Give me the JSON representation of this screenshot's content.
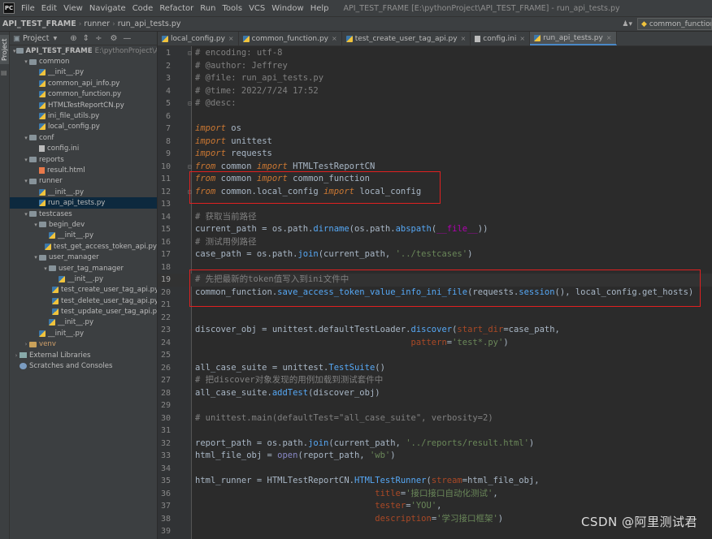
{
  "window": {
    "title": "API_TEST_FRAME [E:\\pythonProject\\API_TEST_FRAME] - run_api_tests.py",
    "menu": [
      "File",
      "Edit",
      "View",
      "Navigate",
      "Code",
      "Refactor",
      "Run",
      "Tools",
      "VCS",
      "Window",
      "Help"
    ]
  },
  "navbar": {
    "crumbs": [
      "API_TEST_FRAME",
      "runner",
      "run_api_tests.py"
    ],
    "run_config": "common_function"
  },
  "side_tab": "Project",
  "project": {
    "header": "Project",
    "tree": [
      {
        "label": "API_TEST_FRAME",
        "extra": "E:\\pythonProject\\AP",
        "type": "folder",
        "indent": 0,
        "open": true,
        "bold": true
      },
      {
        "label": "common",
        "type": "folder",
        "indent": 1,
        "open": true
      },
      {
        "label": "__init__.py",
        "type": "py",
        "indent": 2
      },
      {
        "label": "common_api_info.py",
        "type": "py",
        "indent": 2
      },
      {
        "label": "common_function.py",
        "type": "py",
        "indent": 2
      },
      {
        "label": "HTMLTestReportCN.py",
        "type": "py",
        "indent": 2
      },
      {
        "label": "ini_file_utils.py",
        "type": "py",
        "indent": 2
      },
      {
        "label": "local_config.py",
        "type": "py",
        "indent": 2
      },
      {
        "label": "conf",
        "type": "folder",
        "indent": 1,
        "open": true
      },
      {
        "label": "config.ini",
        "type": "file",
        "indent": 2
      },
      {
        "label": "reports",
        "type": "folder",
        "indent": 1,
        "open": true
      },
      {
        "label": "result.html",
        "type": "html",
        "indent": 2
      },
      {
        "label": "runner",
        "type": "folder",
        "indent": 1,
        "open": true
      },
      {
        "label": "__init__.py",
        "type": "py",
        "indent": 2
      },
      {
        "label": "run_api_tests.py",
        "type": "py",
        "indent": 2,
        "selected": true
      },
      {
        "label": "testcases",
        "type": "folder",
        "indent": 1,
        "open": true
      },
      {
        "label": "begin_dev",
        "type": "folder",
        "indent": 2,
        "open": true
      },
      {
        "label": "__init__.py",
        "type": "py",
        "indent": 3
      },
      {
        "label": "test_get_access_token_api.py",
        "type": "py",
        "indent": 3
      },
      {
        "label": "user_manager",
        "type": "folder",
        "indent": 2,
        "open": true
      },
      {
        "label": "user_tag_manager",
        "type": "folder",
        "indent": 3,
        "open": true
      },
      {
        "label": "__init__.py",
        "type": "py",
        "indent": 4
      },
      {
        "label": "test_create_user_tag_api.py",
        "type": "py",
        "indent": 4
      },
      {
        "label": "test_delete_user_tag_api.py",
        "type": "py",
        "indent": 4
      },
      {
        "label": "test_update_user_tag_api.py",
        "type": "py",
        "indent": 4
      },
      {
        "label": "__init__.py",
        "type": "py",
        "indent": 3
      },
      {
        "label": "__init__.py",
        "type": "py",
        "indent": 2
      },
      {
        "label": "venv",
        "type": "folder",
        "indent": 1,
        "open": false,
        "orange": true
      },
      {
        "label": "External Libraries",
        "type": "lib",
        "indent": 0,
        "open": false
      },
      {
        "label": "Scratches and Consoles",
        "type": "scratch",
        "indent": 0
      }
    ]
  },
  "tabs": [
    {
      "label": "local_config.py",
      "active": false
    },
    {
      "label": "common_function.py",
      "active": false
    },
    {
      "label": "test_create_user_tag_api.py",
      "active": false
    },
    {
      "label": "config.ini",
      "active": false
    },
    {
      "label": "run_api_tests.py",
      "active": true
    }
  ],
  "editor": {
    "current_line": 19,
    "lines": [
      {
        "n": 1,
        "tokens": [
          [
            "com",
            "# encoding: utf-8"
          ]
        ]
      },
      {
        "n": 2,
        "tokens": [
          [
            "com",
            "# @author: Jeffrey"
          ]
        ]
      },
      {
        "n": 3,
        "tokens": [
          [
            "com",
            "# @file: run_api_tests.py"
          ]
        ]
      },
      {
        "n": 4,
        "tokens": [
          [
            "com",
            "# @time: 2022/7/24 17:52"
          ]
        ]
      },
      {
        "n": 5,
        "tokens": [
          [
            "com",
            "# @desc:"
          ]
        ]
      },
      {
        "n": 6,
        "tokens": []
      },
      {
        "n": 7,
        "tokens": [
          [
            "kwimp",
            "import"
          ],
          [
            "plain",
            " os"
          ]
        ]
      },
      {
        "n": 8,
        "tokens": [
          [
            "kwimp",
            "import"
          ],
          [
            "plain",
            " unittest"
          ]
        ]
      },
      {
        "n": 9,
        "tokens": [
          [
            "kwimp",
            "import"
          ],
          [
            "plain",
            " requests"
          ]
        ]
      },
      {
        "n": 10,
        "tokens": [
          [
            "kwimp",
            "from"
          ],
          [
            "plain",
            " common "
          ],
          [
            "kwimp",
            "import"
          ],
          [
            "plain",
            " HTMLTestReportCN"
          ]
        ]
      },
      {
        "n": 11,
        "tokens": [
          [
            "kwimp",
            "from"
          ],
          [
            "plain",
            " common "
          ],
          [
            "kwimp",
            "import"
          ],
          [
            "plain",
            " common_function"
          ]
        ]
      },
      {
        "n": 12,
        "tokens": [
          [
            "kwimp",
            "from"
          ],
          [
            "plain",
            " common.local_config "
          ],
          [
            "kwimp",
            "import"
          ],
          [
            "plain",
            " local_config"
          ]
        ]
      },
      {
        "n": 13,
        "tokens": []
      },
      {
        "n": 14,
        "tokens": [
          [
            "com",
            "# 获取当前路径"
          ]
        ]
      },
      {
        "n": 15,
        "tokens": [
          [
            "plain",
            "current_path = os.path."
          ],
          [
            "call",
            "dirname"
          ],
          [
            "plain",
            "(os.path."
          ],
          [
            "call",
            "abspath"
          ],
          [
            "plain",
            "("
          ],
          [
            "dunder",
            "__file__"
          ],
          [
            "plain",
            "))"
          ]
        ]
      },
      {
        "n": 16,
        "tokens": [
          [
            "com",
            "# 测试用例路径"
          ]
        ]
      },
      {
        "n": 17,
        "tokens": [
          [
            "plain",
            "case_path = os.path."
          ],
          [
            "call",
            "join"
          ],
          [
            "plain",
            "(current_path, "
          ],
          [
            "str",
            "'../testcases'"
          ],
          [
            "plain",
            ")"
          ]
        ]
      },
      {
        "n": 18,
        "tokens": []
      },
      {
        "n": 19,
        "tokens": [
          [
            "com",
            "# 先把最新的token值写入到ini文件中"
          ]
        ]
      },
      {
        "n": 20,
        "tokens": [
          [
            "plain",
            "common_function."
          ],
          [
            "call",
            "save_access_token_value_info_ini_file"
          ],
          [
            "plain",
            "(requests."
          ],
          [
            "call",
            "session"
          ],
          [
            "plain",
            "(), local_config.get_hosts)"
          ]
        ]
      },
      {
        "n": 21,
        "tokens": []
      },
      {
        "n": 22,
        "tokens": []
      },
      {
        "n": 23,
        "tokens": [
          [
            "plain",
            "discover_obj = unittest.defaultTestLoader."
          ],
          [
            "call",
            "discover"
          ],
          [
            "plain",
            "("
          ],
          [
            "param",
            "start_dir"
          ],
          [
            "plain",
            "=case_path,"
          ]
        ]
      },
      {
        "n": 24,
        "tokens": [
          [
            "plain",
            "                                          "
          ],
          [
            "param",
            "pattern"
          ],
          [
            "plain",
            "="
          ],
          [
            "str",
            "'test*.py'"
          ],
          [
            "plain",
            ")"
          ]
        ]
      },
      {
        "n": 25,
        "tokens": []
      },
      {
        "n": 26,
        "tokens": [
          [
            "plain",
            "all_case_suite = unittest."
          ],
          [
            "call",
            "TestSuite"
          ],
          [
            "plain",
            "()"
          ]
        ]
      },
      {
        "n": 27,
        "tokens": [
          [
            "com",
            "# 把discover对象发现的用例加载到测试套件中"
          ]
        ]
      },
      {
        "n": 28,
        "tokens": [
          [
            "plain",
            "all_case_suite."
          ],
          [
            "call",
            "addTest"
          ],
          [
            "plain",
            "(discover_obj)"
          ]
        ]
      },
      {
        "n": 29,
        "tokens": []
      },
      {
        "n": 30,
        "tokens": [
          [
            "com",
            "# unittest.main(defaultTest=\"all_case_suite\", verbosity=2)"
          ]
        ]
      },
      {
        "n": 31,
        "tokens": []
      },
      {
        "n": 32,
        "tokens": [
          [
            "plain",
            "report_path = os.path."
          ],
          [
            "call",
            "join"
          ],
          [
            "plain",
            "(current_path, "
          ],
          [
            "str",
            "'../reports/result.html'"
          ],
          [
            "plain",
            ")"
          ]
        ]
      },
      {
        "n": 33,
        "tokens": [
          [
            "plain",
            "html_file_obj = "
          ],
          [
            "builtin",
            "open"
          ],
          [
            "plain",
            "(report_path, "
          ],
          [
            "str",
            "'wb'"
          ],
          [
            "plain",
            ")"
          ]
        ]
      },
      {
        "n": 34,
        "tokens": []
      },
      {
        "n": 35,
        "tokens": [
          [
            "plain",
            "html_runner = HTMLTestReportCN."
          ],
          [
            "call",
            "HTMLTestRunner"
          ],
          [
            "plain",
            "("
          ],
          [
            "param",
            "stream"
          ],
          [
            "plain",
            "=html_file_obj,"
          ]
        ]
      },
      {
        "n": 36,
        "tokens": [
          [
            "plain",
            "                                   "
          ],
          [
            "param",
            "title"
          ],
          [
            "plain",
            "="
          ],
          [
            "str",
            "'接口接口自动化测试'"
          ],
          [
            "plain",
            ","
          ]
        ]
      },
      {
        "n": 37,
        "tokens": [
          [
            "plain",
            "                                   "
          ],
          [
            "param",
            "tester"
          ],
          [
            "plain",
            "="
          ],
          [
            "str",
            "'YOU'"
          ],
          [
            "plain",
            ","
          ]
        ]
      },
      {
        "n": 38,
        "tokens": [
          [
            "plain",
            "                                   "
          ],
          [
            "param",
            "description"
          ],
          [
            "plain",
            "="
          ],
          [
            "str",
            "'学习接口框架'"
          ],
          [
            "plain",
            ")"
          ]
        ]
      },
      {
        "n": 39,
        "tokens": []
      }
    ]
  },
  "watermark": "CSDN @阿里测试君",
  "colors": {
    "accent": "#4a88c7",
    "highlight_box": "#e02020",
    "keyword": "#cc7832",
    "string": "#6a8759",
    "comment": "#808080"
  }
}
